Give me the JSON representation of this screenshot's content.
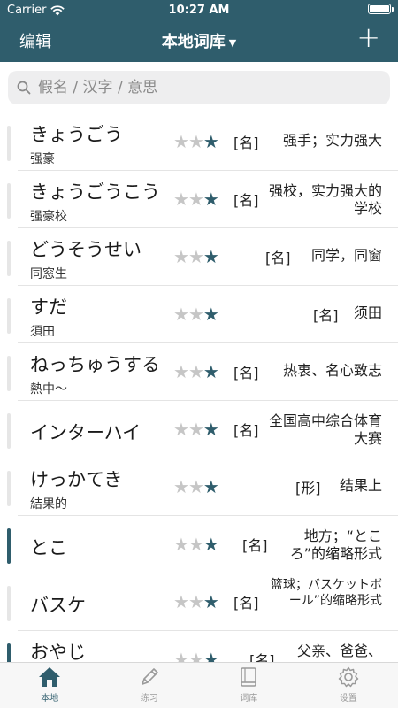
{
  "status": {
    "carrier": "Carrier",
    "time": "10:27 AM"
  },
  "nav": {
    "edit": "编辑",
    "title": "本地词库",
    "add": "+"
  },
  "search": {
    "placeholder": "假名 / 汉字 / 意思"
  },
  "colors": {
    "accent": "#2f5d6c",
    "star_off": "#c6c6c6",
    "active_bar": "#2f5d6c",
    "inactive_bar": "#e6e6e6"
  },
  "words": [
    {
      "kana": "きょうごう",
      "kanji": "强豪",
      "stars": 1,
      "pos": "[名]",
      "meaning": "强手；实力强大",
      "marked": true
    },
    {
      "kana": "きょうごうこう",
      "kanji": "强豪校",
      "stars": 1,
      "pos": "[名]",
      "meaning": "强校，实力强大的学校",
      "marked": false
    },
    {
      "kana": "どうそうせい",
      "kanji": "同窓生",
      "stars": 1,
      "pos": "[名]",
      "meaning": "同学，同窗",
      "marked": false
    },
    {
      "kana": "すだ",
      "kanji": "須田",
      "stars": 1,
      "pos": "[名]",
      "meaning": "须田",
      "marked": false
    },
    {
      "kana": "ねっちゅうする",
      "kanji": "熱中～",
      "stars": 1,
      "pos": "[名]",
      "meaning": "热衷、名心致志",
      "marked": false
    },
    {
      "kana": "インターハイ",
      "kanji": "",
      "stars": 1,
      "pos": "[名]",
      "meaning": "全国高中综合体育大赛",
      "marked": false
    },
    {
      "kana": "けっかてき",
      "kanji": "結果的",
      "stars": 1,
      "pos": "[形]",
      "meaning": "结果上",
      "marked": false
    },
    {
      "kana": "とこ",
      "kanji": "",
      "stars": 1,
      "pos": "[名]",
      "meaning": "地方；“ところ”的缩略形式",
      "marked": true
    },
    {
      "kana": "バスケ",
      "kanji": "",
      "stars": 1,
      "pos": "[名]",
      "meaning": "篮球；バスケットボール”的缩略形式",
      "marked": false
    },
    {
      "kana": "おやじ",
      "kanji": "",
      "stars": 1,
      "pos": "[名]",
      "meaning": "父亲、爸爸、",
      "marked": true
    }
  ],
  "tabs": [
    {
      "label": "本地",
      "icon": "home-icon",
      "active": true
    },
    {
      "label": "练习",
      "icon": "pencil-icon",
      "active": false
    },
    {
      "label": "词库",
      "icon": "book-icon",
      "active": false
    },
    {
      "label": "设置",
      "icon": "gear-icon",
      "active": false
    }
  ]
}
